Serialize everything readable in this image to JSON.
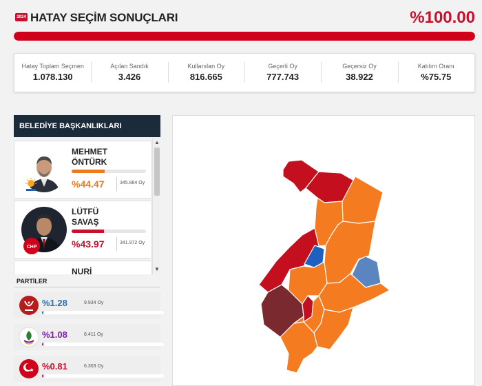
{
  "header": {
    "year_badge": "2024",
    "title": "HATAY SEÇİM SONUÇLARI",
    "opened_percent_label": "%100.00",
    "opened_fraction": 1.0
  },
  "stats": [
    {
      "label": "Hatay Toplam Seçmen",
      "value": "1.078.130"
    },
    {
      "label": "Açılan Sandık",
      "value": "3.426"
    },
    {
      "label": "Kullanılan Oy",
      "value": "816.665"
    },
    {
      "label": "Geçerli Oy",
      "value": "777.743"
    },
    {
      "label": "Geçersiz Oy",
      "value": "38.922"
    },
    {
      "label": "Katılım Oranı",
      "value": "%75.75"
    }
  ],
  "mayors": {
    "title": "BELEDİYE BAŞKANLIKLARI",
    "candidates": [
      {
        "name_line1": "MEHMET",
        "name_line2": "ÖNTÜRK",
        "percent": "%44.47",
        "votes": "345.884 Oy",
        "share": 0.4447,
        "color": "#f07a1a",
        "party_logo": "ak-parti-logo"
      },
      {
        "name_line1": "LÜTFÜ",
        "name_line2": "SAVAŞ",
        "percent": "%43.97",
        "votes": "341.972 Oy",
        "share": 0.4397,
        "color": "#c8102e",
        "party_logo": "chp-logo",
        "party_logo_text": "CHP"
      },
      {
        "name_line1": "NURİ",
        "name_line2": ""
      }
    ]
  },
  "parties": {
    "title": "PARTİLER",
    "items": [
      {
        "percent": "%1.28",
        "votes": "9.934 Oy",
        "share": 0.0128,
        "color": "#2a6fa8",
        "logo_color": "#b71c1c",
        "logo": "zafer-partisi-logo"
      },
      {
        "percent": "%1.08",
        "votes": "8.411 Oy",
        "share": 0.0108,
        "color": "#7b1fa2",
        "logo_color": "#ffffff",
        "logo": "dem-parti-logo"
      },
      {
        "percent": "%0.81",
        "votes": "6.303 Oy",
        "share": 0.0081,
        "color": "#c8102e",
        "logo_color": "#d0021b",
        "logo": "saadet-logo"
      }
    ]
  },
  "map": {
    "colors": {
      "orange": "#f47b20",
      "red": "#c40f1e",
      "dark_red": "#7a2a2e",
      "blue": "#1f5fbf",
      "steel_blue": "#5b85c0"
    }
  }
}
